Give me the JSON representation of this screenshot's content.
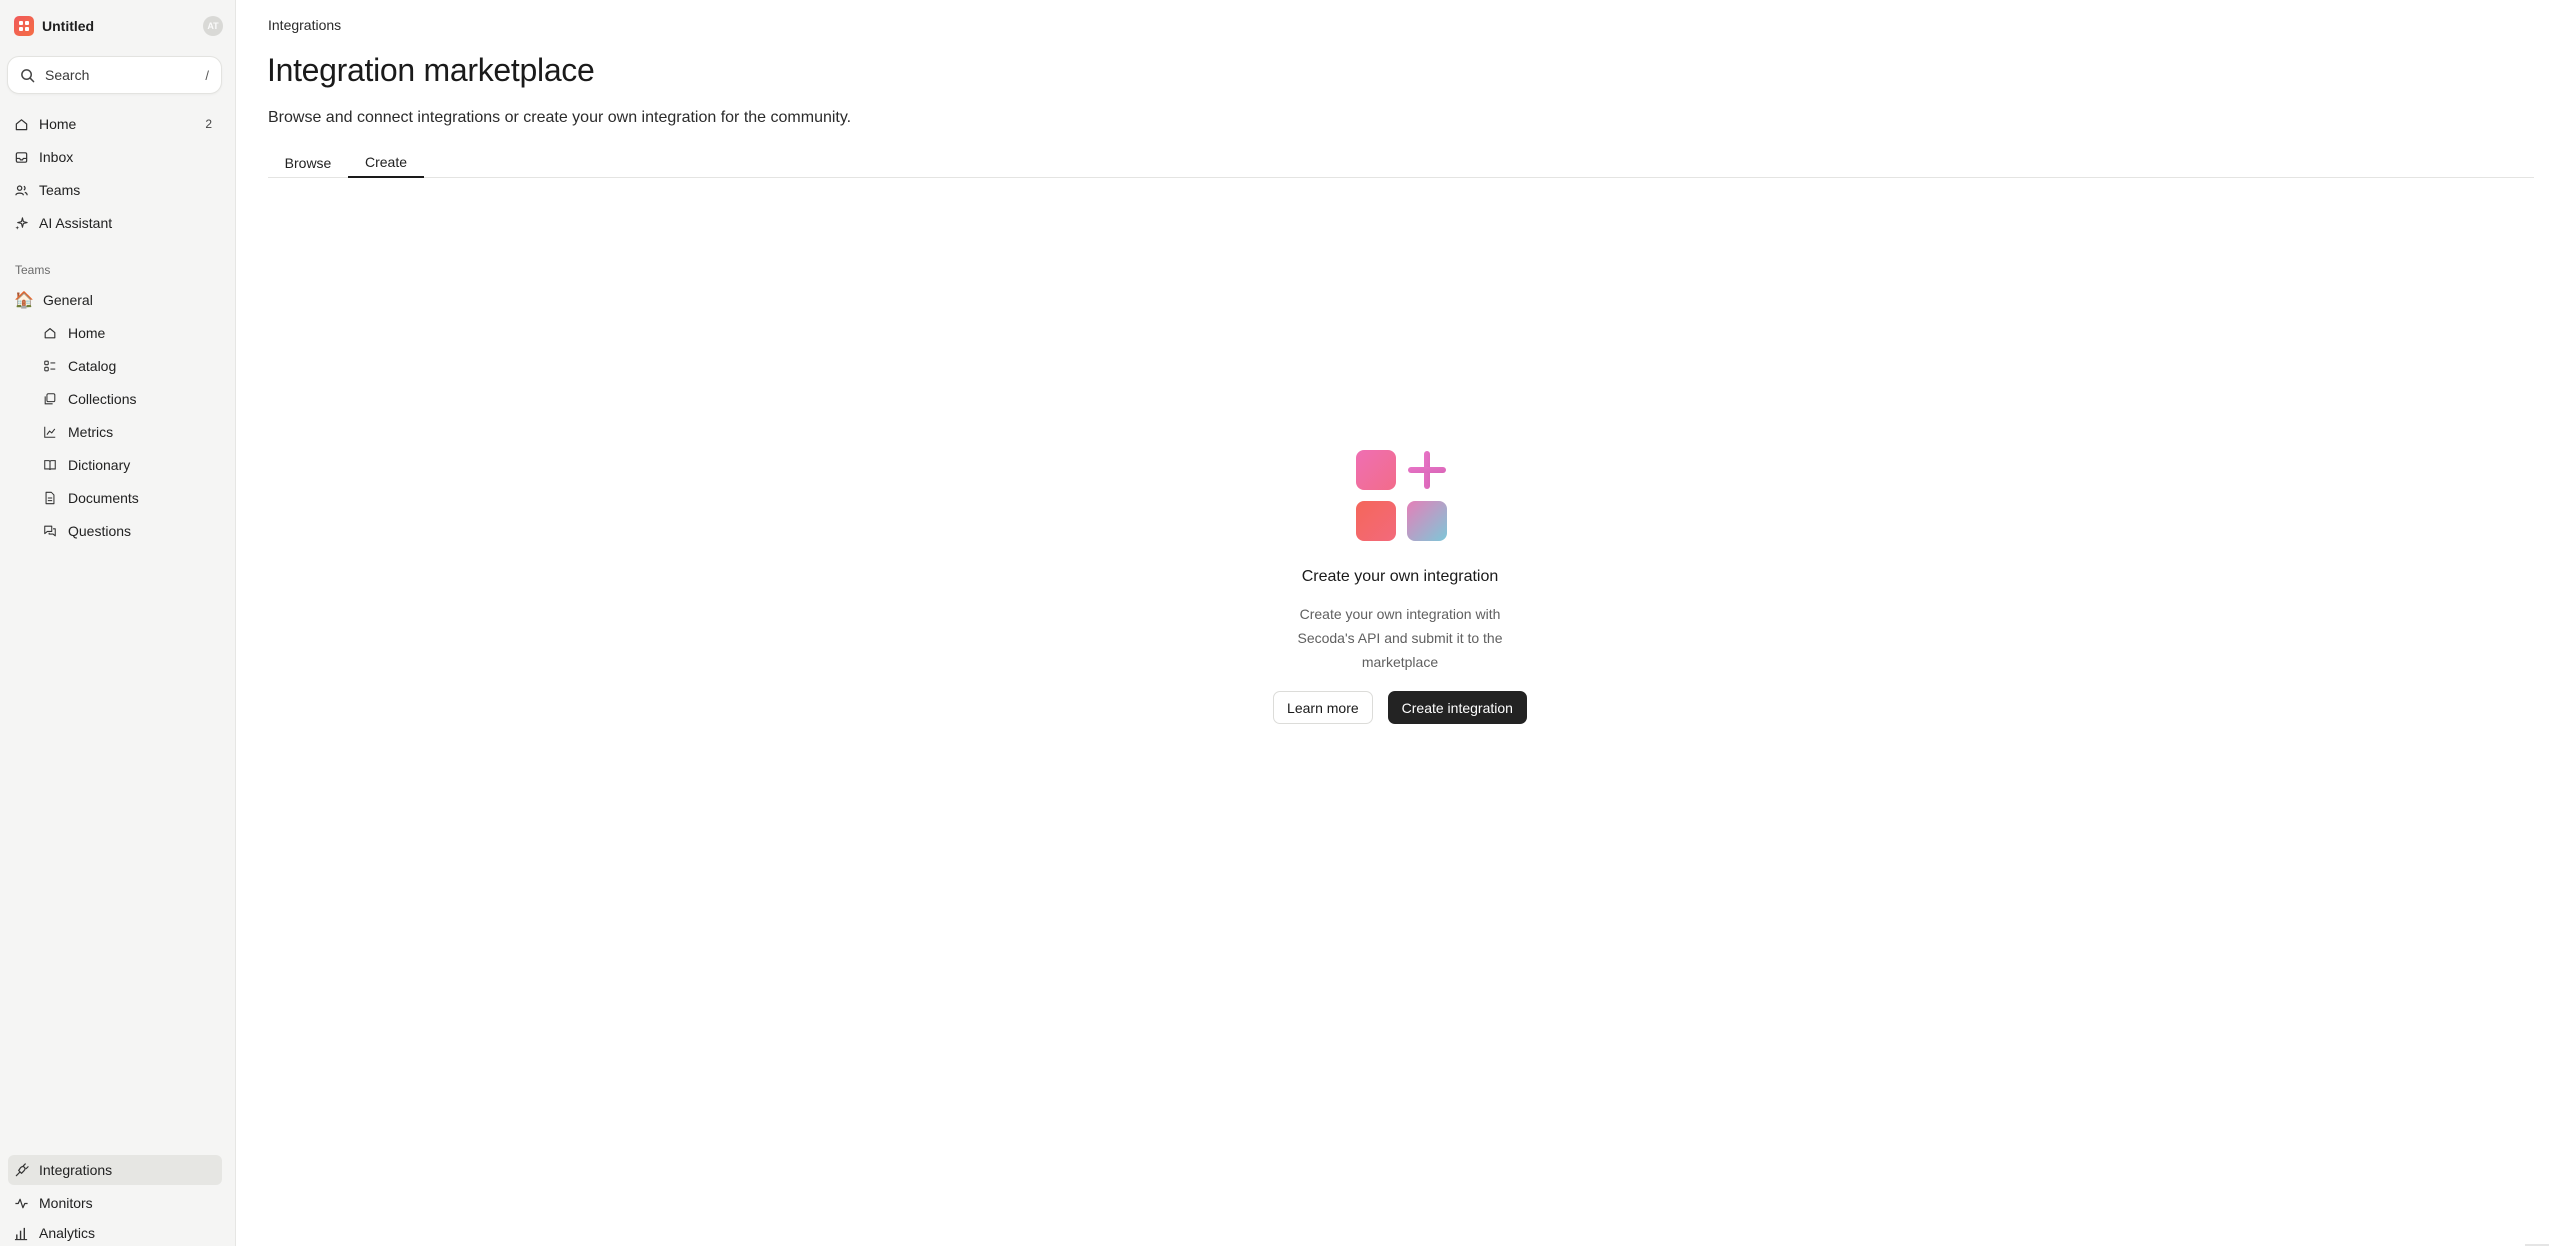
{
  "workspace": {
    "name": "Untitled",
    "avatar_initials": "AT"
  },
  "search": {
    "label": "Search",
    "shortcut": "/"
  },
  "nav": {
    "primary": [
      {
        "label": "Home",
        "icon": "home-icon",
        "count": "2"
      },
      {
        "label": "Inbox",
        "icon": "inbox-icon",
        "count": ""
      },
      {
        "label": "Teams",
        "icon": "users-icon",
        "count": ""
      },
      {
        "label": "AI Assistant",
        "icon": "sparkle-icon",
        "count": ""
      }
    ],
    "teams_section_label": "Teams",
    "team": {
      "label": "General",
      "emoji": "🏠"
    },
    "team_items": [
      {
        "label": "Home",
        "icon": "home-icon"
      },
      {
        "label": "Catalog",
        "icon": "catalog-icon"
      },
      {
        "label": "Collections",
        "icon": "collections-icon"
      },
      {
        "label": "Metrics",
        "icon": "metrics-icon"
      },
      {
        "label": "Dictionary",
        "icon": "book-icon"
      },
      {
        "label": "Documents",
        "icon": "document-icon"
      },
      {
        "label": "Questions",
        "icon": "questions-icon"
      }
    ],
    "bottom": [
      {
        "label": "Integrations",
        "icon": "plug-icon",
        "active": true
      },
      {
        "label": "Monitors",
        "icon": "pulse-icon"
      },
      {
        "label": "Analytics",
        "icon": "bar-chart-icon"
      }
    ]
  },
  "main": {
    "breadcrumb": "Integrations",
    "title": "Integration marketplace",
    "subtitle": "Browse and connect integrations or create your own integration for the community.",
    "tabs": [
      {
        "label": "Browse",
        "active": false
      },
      {
        "label": "Create",
        "active": true
      }
    ],
    "empty_state": {
      "title": "Create your own integration",
      "description": "Create your own integration with Secoda's API and submit it to the marketplace",
      "secondary_button": "Learn more",
      "primary_button": "Create integration"
    }
  },
  "colors": {
    "sidebar_bg": "#f5f5f4",
    "brand": "#f05a5a",
    "primary_button": "#232323",
    "active_nav": "#e6e6e3"
  }
}
